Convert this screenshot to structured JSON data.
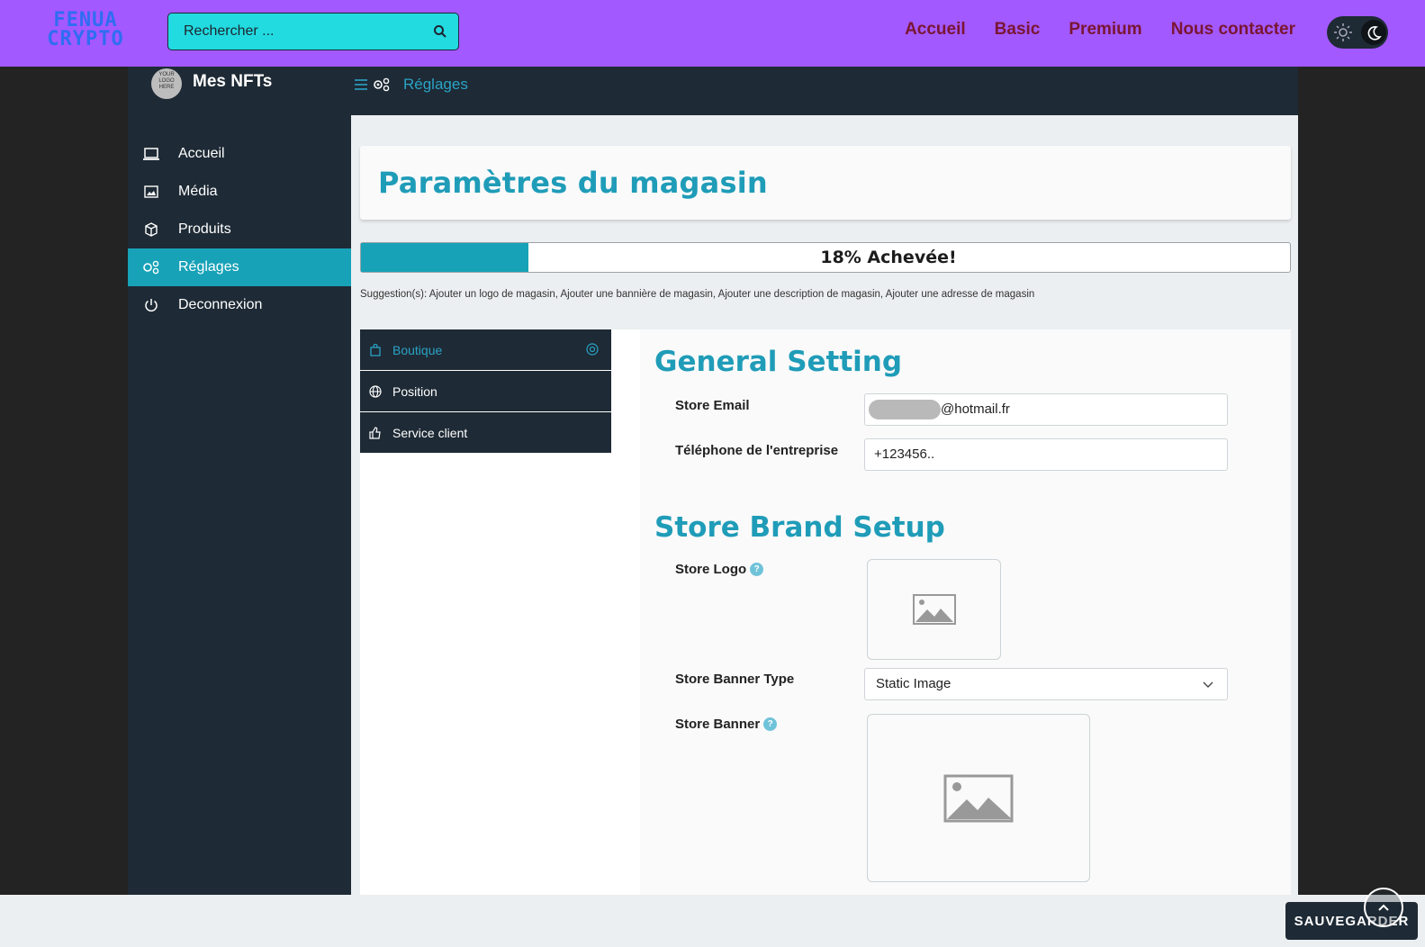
{
  "brand": {
    "line1": "FENUA",
    "line2": "CRYPTO"
  },
  "search": {
    "placeholder": "Rechercher ..."
  },
  "nav": [
    "Accueil",
    "Basic",
    "Premium",
    "Nous contacter"
  ],
  "sidebar": {
    "title": "Mes NFTs",
    "avatar_text": "YOUR LOGO HERE",
    "items": [
      {
        "label": "Accueil",
        "icon": "laptop-icon"
      },
      {
        "label": "Média",
        "icon": "image-icon"
      },
      {
        "label": "Produits",
        "icon": "box-icon"
      },
      {
        "label": "Réglages",
        "icon": "gears-icon",
        "active": true
      },
      {
        "label": "Deconnexion",
        "icon": "power-icon"
      }
    ]
  },
  "breadcrumb": {
    "current": "Réglages"
  },
  "page": {
    "title": "Paramètres du magasin"
  },
  "progress": {
    "percent": 18,
    "label": "18% Achevée!",
    "suggestion": "Suggestion(s): Ajouter un logo de magasin, Ajouter une bannière de magasin, Ajouter une description de magasin, Ajouter une adresse de magasin"
  },
  "tabs": [
    {
      "label": "Boutique",
      "icon": "shopping-bag-icon",
      "active": true
    },
    {
      "label": "Position",
      "icon": "globe-icon"
    },
    {
      "label": "Service client",
      "icon": "thumbs-up-icon"
    }
  ],
  "general": {
    "title": "General Setting",
    "email_label": "Store Email",
    "email_value": "@hotmail.fr",
    "phone_label": "Téléphone de l'entreprise",
    "phone_value": "+123456.."
  },
  "brand_setup": {
    "title": "Store Brand Setup",
    "logo_label": "Store Logo",
    "banner_type_label": "Store Banner Type",
    "banner_type_value": "Static Image",
    "banner_label": "Store Banner"
  },
  "footer": {
    "save_label": "SAUVEGARDER"
  },
  "colors": {
    "topbar": "#a259ff",
    "accent": "#17a2b8",
    "dark": "#1e2a35",
    "search": "#22dbe0"
  }
}
